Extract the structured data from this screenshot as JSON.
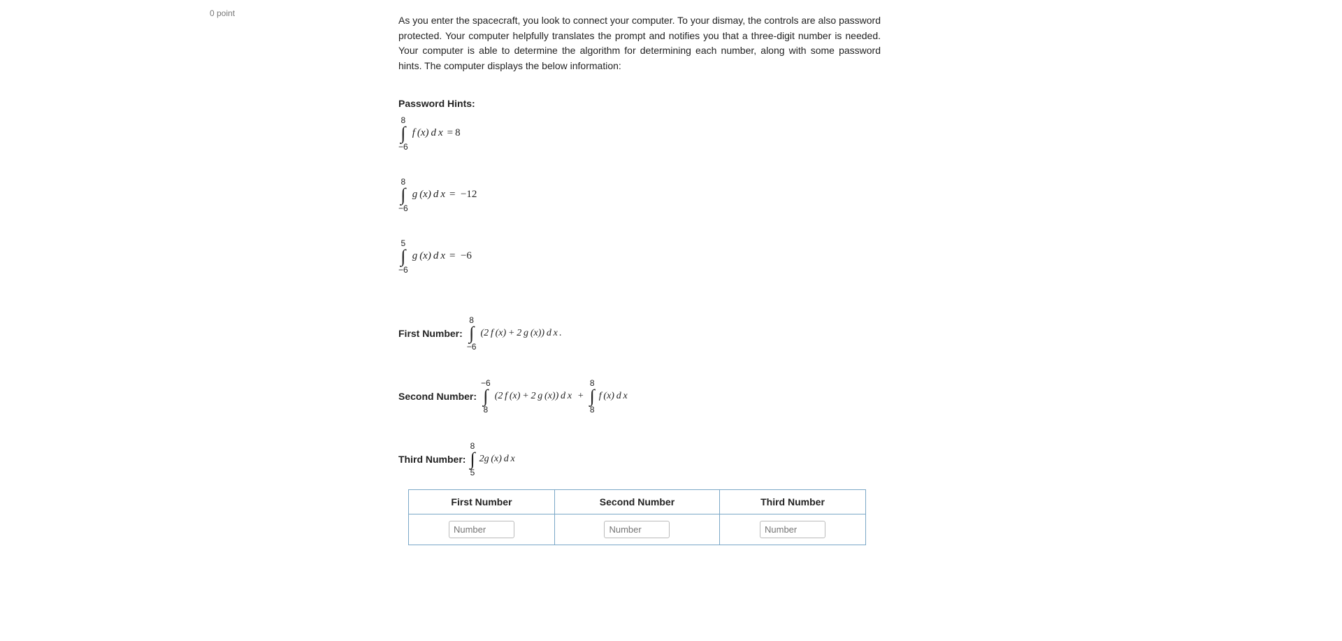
{
  "points_label": "0 point",
  "story": "As you enter the spacecraft, you look to connect your computer. To your dismay, the controls are also password protected. Your computer helpfully translates the prompt and notifies you that a three-digit number is needed. Your computer is able to determine the algorithm for determining each number, along with some password hints. The computer displays the below information:",
  "hints_title": "Password Hints:",
  "hints": {
    "h1": {
      "upper": "8",
      "lower": "−6",
      "body": "f (x) d x",
      "eq": "= 8"
    },
    "h2": {
      "upper": "8",
      "lower": "−6",
      "body": "g (x) d x",
      "eq": "= −12"
    },
    "h3": {
      "upper": "5",
      "lower": "−6",
      "body": "g (x) d x",
      "eq": "= −6"
    }
  },
  "prompts": {
    "first": {
      "label": "First Number:",
      "int1": {
        "upper": "8",
        "lower": "−6"
      },
      "body1": "(2 f (x) + 2 g (x)) d x",
      "tail": "."
    },
    "second": {
      "label": "Second Number:",
      "int1": {
        "upper": "−6",
        "lower": "8"
      },
      "body1": "(2 f (x) + 2 g (x)) d x",
      "plus": " + ",
      "int2": {
        "upper": "8",
        "lower": "8"
      },
      "body2": "f (x) d x"
    },
    "third": {
      "label": "Third Number:",
      "int1": {
        "upper": "8",
        "lower": "5"
      },
      "body1": "2g (x) d x"
    }
  },
  "table": {
    "headers": [
      "First Number",
      "Second Number",
      "Third Number"
    ],
    "placeholder": "Number"
  }
}
